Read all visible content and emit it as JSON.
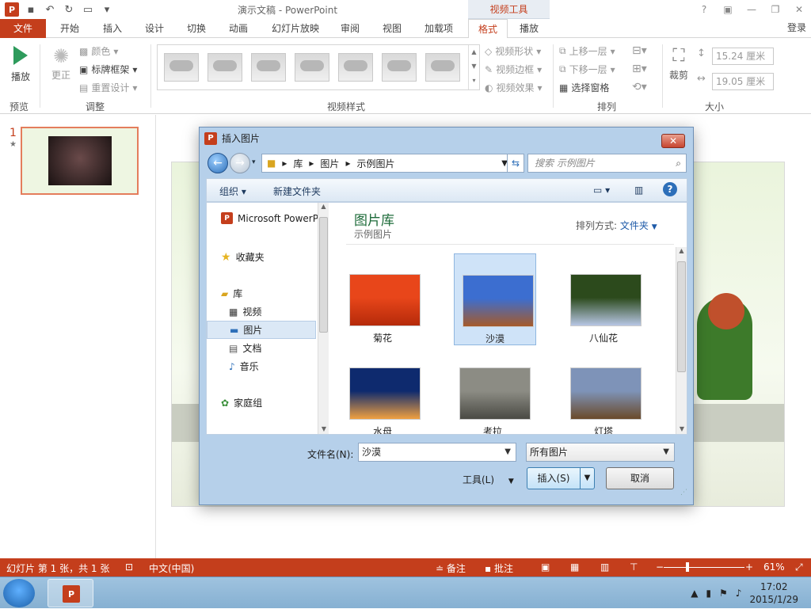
{
  "window": {
    "title": "演示文稿 - PowerPoint",
    "context_tab_group": "视频工具",
    "login": "登录",
    "controls": [
      "?",
      "▣",
      "—",
      "❐",
      "✕"
    ]
  },
  "tabs": [
    {
      "label": "文件"
    },
    {
      "label": "开始"
    },
    {
      "label": "插入"
    },
    {
      "label": "设计"
    },
    {
      "label": "切换"
    },
    {
      "label": "动画"
    },
    {
      "label": "幻灯片放映"
    },
    {
      "label": "审阅"
    },
    {
      "label": "视图"
    },
    {
      "label": "加载项"
    },
    {
      "label": "格式"
    },
    {
      "label": "播放"
    }
  ],
  "ribbon": {
    "preview": {
      "play": "播放",
      "group": "预览"
    },
    "adjust": {
      "correct": "更正",
      "color": "颜色",
      "poster_frame": "标牌框架",
      "reset_design": "重置设计",
      "group": "调整"
    },
    "video_styles": {
      "group": "视频样式",
      "shape": "视频形状",
      "border": "视频边框",
      "effects": "视频效果"
    },
    "arrange": {
      "bring_forward": "上移一层",
      "send_backward": "下移一层",
      "selection_pane": "选择窗格",
      "group": "排列"
    },
    "size": {
      "crop": "裁剪",
      "height": "15.24 厘米",
      "width": "19.05 厘米",
      "group": "大小"
    }
  },
  "slide_panel": {
    "number": "1",
    "star": "★"
  },
  "dialog": {
    "title": "插入图片",
    "close": "✕",
    "breadcrumb": [
      "库",
      "图片",
      "示例图片"
    ],
    "search_placeholder": "搜索 示例图片",
    "toolbar": {
      "organize": "组织",
      "new_folder": "新建文件夹"
    },
    "nav": {
      "microsoft": "Microsoft PowerP",
      "favorites": "收藏夹",
      "libraries": "库",
      "videos": "视频",
      "pictures": "图片",
      "documents": "文档",
      "music": "音乐",
      "homegroup": "家庭组"
    },
    "library_title": "图片库",
    "library_subtitle": "示例图片",
    "arrange_label": "排列方式:",
    "arrange_value": "文件夹",
    "images": [
      {
        "name": "菊花",
        "colors": [
          "#e8461a",
          "#b52a0a"
        ]
      },
      {
        "name": "沙漠",
        "colors": [
          "#3c6ed0",
          "#a65a2a"
        ]
      },
      {
        "name": "八仙花",
        "colors": [
          "#2c4a1c",
          "#b7c6e4"
        ]
      },
      {
        "name": "水母",
        "colors": [
          "#0e2a6e",
          "#f0a040"
        ]
      },
      {
        "name": "考拉",
        "colors": [
          "#8c8c84",
          "#4a4a44"
        ]
      },
      {
        "name": "灯塔",
        "colors": [
          "#7e93b8",
          "#6a4a2a"
        ]
      }
    ],
    "filename_label": "文件名(N):",
    "filename_value": "沙漠",
    "filetype_value": "所有图片",
    "tools_label": "工具(L)",
    "insert_label": "插入(S)",
    "cancel_label": "取消"
  },
  "statusbar": {
    "slide_info": "幻灯片 第 1 张，共 1 张",
    "language": "中文(中国)",
    "notes": "备注",
    "comments": "批注",
    "zoom": "61%"
  },
  "taskbar": {
    "time": "17:02",
    "date": "2015/1/29"
  },
  "colors": {
    "accent": "#c43e1c",
    "dialog_frame": "#b6d0ea"
  }
}
